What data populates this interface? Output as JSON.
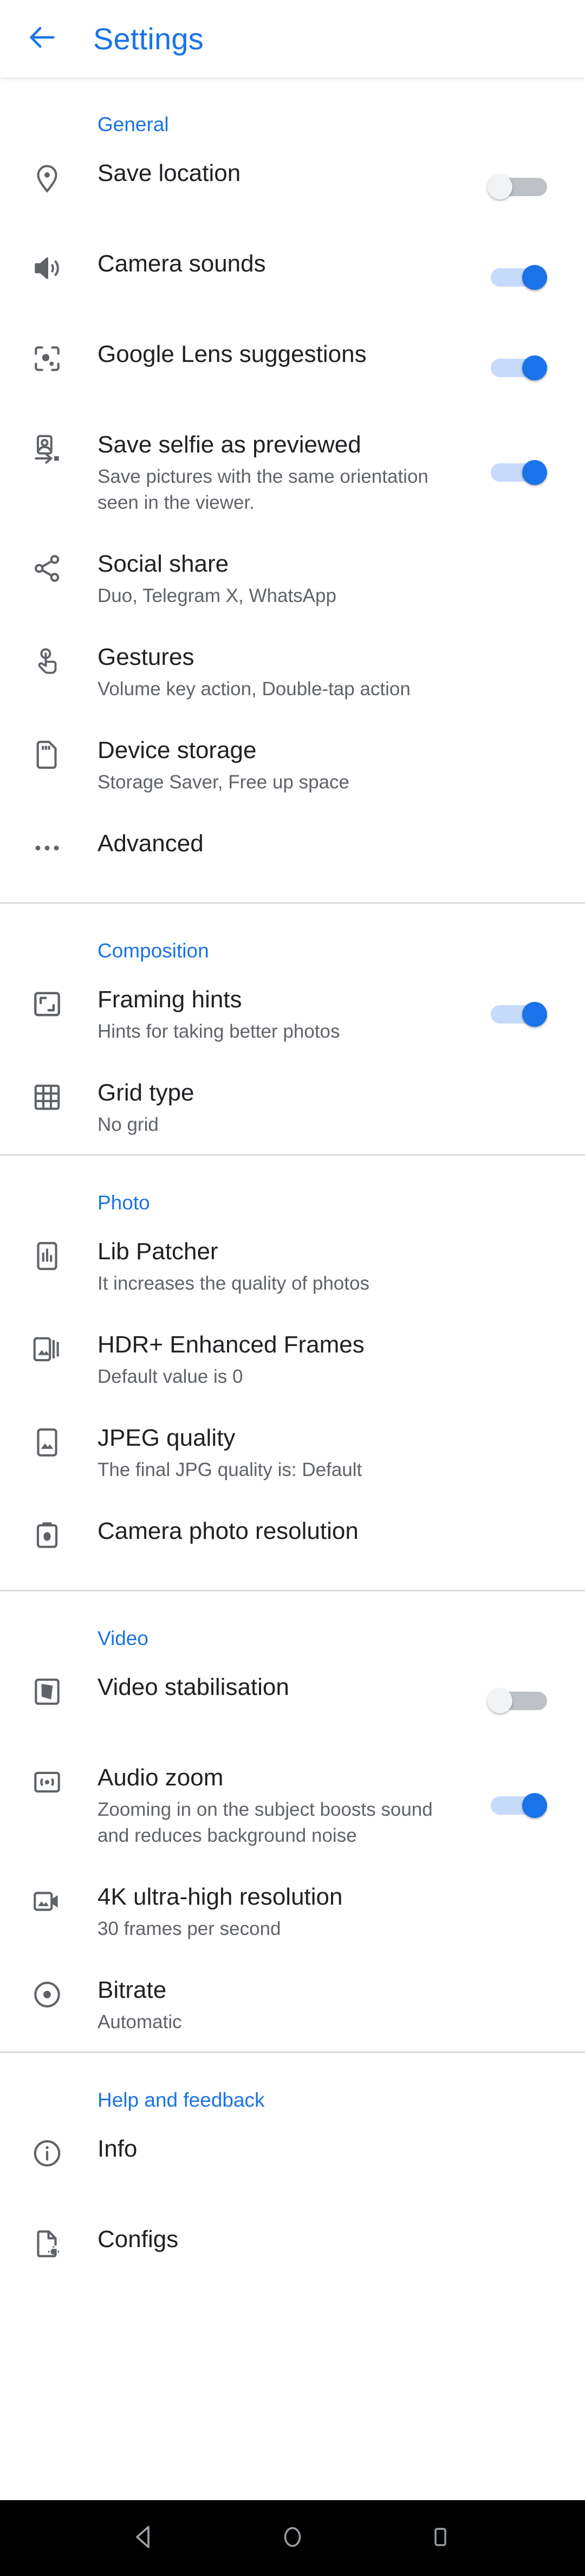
{
  "appbar": {
    "back_icon": "arrow-back-icon",
    "title": "Settings",
    "accent_color": "#1a73e8"
  },
  "sections": [
    {
      "key": "general",
      "header": "General",
      "items": [
        {
          "icon": "location-pin-icon",
          "title": "Save location",
          "subtitle": "",
          "control": "toggle",
          "toggle_state": "off"
        },
        {
          "icon": "volume-up-icon",
          "title": "Camera sounds",
          "subtitle": "",
          "control": "toggle",
          "toggle_state": "on"
        },
        {
          "icon": "google-lens-icon",
          "title": "Google Lens suggestions",
          "subtitle": "",
          "control": "toggle",
          "toggle_state": "on"
        },
        {
          "icon": "flip-selfie-icon",
          "title": "Save selfie as previewed",
          "subtitle": "Save pictures with the same orientation seen in the viewer.",
          "control": "toggle",
          "toggle_state": "on"
        },
        {
          "icon": "share-icon",
          "title": "Social share",
          "subtitle": "Duo, Telegram X, WhatsApp",
          "control": "none",
          "toggle_state": ""
        },
        {
          "icon": "touch-gesture-icon",
          "title": "Gestures",
          "subtitle": "Volume key action, Double-tap action",
          "control": "none",
          "toggle_state": ""
        },
        {
          "icon": "sd-card-icon",
          "title": "Device storage",
          "subtitle": "Storage Saver, Free up space",
          "control": "none",
          "toggle_state": ""
        },
        {
          "icon": "more-horizontal-icon",
          "title": "Advanced",
          "subtitle": "",
          "control": "none",
          "toggle_state": ""
        }
      ]
    },
    {
      "key": "composition",
      "header": "Composition",
      "items": [
        {
          "icon": "framing-hints-icon",
          "title": "Framing hints",
          "subtitle": "Hints for taking better photos",
          "control": "toggle",
          "toggle_state": "on"
        },
        {
          "icon": "grid-icon",
          "title": "Grid type",
          "subtitle": "No grid",
          "control": "none",
          "toggle_state": ""
        }
      ]
    },
    {
      "key": "photo",
      "header": "Photo",
      "items": [
        {
          "icon": "bar-chart-phone-icon",
          "title": "Lib Patcher",
          "subtitle": "It increases the quality of photos",
          "control": "none",
          "toggle_state": ""
        },
        {
          "icon": "burst-frames-icon",
          "title": "HDR+ Enhanced Frames",
          "subtitle": "Default value is 0",
          "control": "none",
          "toggle_state": ""
        },
        {
          "icon": "photo-image-icon",
          "title": "JPEG quality",
          "subtitle": "The final JPG quality is: Default",
          "control": "none",
          "toggle_state": ""
        },
        {
          "icon": "camera-icon",
          "title": "Camera photo resolution",
          "subtitle": "",
          "control": "none",
          "toggle_state": ""
        }
      ]
    },
    {
      "key": "video",
      "header": "Video",
      "items": [
        {
          "icon": "video-stabilisation-icon",
          "title": "Video stabilisation",
          "subtitle": "",
          "control": "toggle",
          "toggle_state": "off"
        },
        {
          "icon": "audio-zoom-icon",
          "title": "Audio zoom",
          "subtitle": "Zooming in on the subject boosts sound and reduces background noise",
          "control": "toggle",
          "toggle_state": "on"
        },
        {
          "icon": "video-camera-icon",
          "title": "4K ultra-high resolution",
          "subtitle": "30 frames per second",
          "control": "none",
          "toggle_state": ""
        },
        {
          "icon": "record-dot-icon",
          "title": "Bitrate",
          "subtitle": "Automatic",
          "control": "none",
          "toggle_state": ""
        }
      ]
    },
    {
      "key": "help",
      "header": "Help and feedback",
      "items": [
        {
          "icon": "info-circle-icon",
          "title": "Info",
          "subtitle": "",
          "control": "none",
          "toggle_state": ""
        },
        {
          "icon": "file-config-icon",
          "title": "Configs",
          "subtitle": "",
          "control": "none",
          "toggle_state": ""
        }
      ]
    }
  ],
  "navbar": {
    "back": "nav-back-icon",
    "home": "nav-home-icon",
    "recents": "nav-recents-icon"
  }
}
